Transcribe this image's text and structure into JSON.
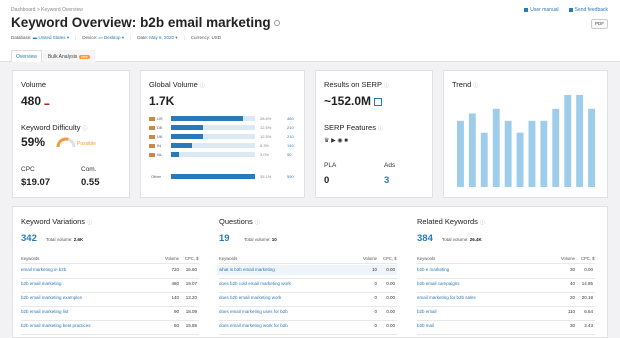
{
  "breadcrumb": [
    "Dashboard",
    "Keyword Overview"
  ],
  "top_links": {
    "manual": "User manual",
    "feedback": "Send feedback"
  },
  "title_prefix": "Keyword Overview:",
  "query": "b2b email marketing",
  "pdf_label": "PDF",
  "meta": {
    "db_label": "Database:",
    "db_value": "United States",
    "device_label": "Device:",
    "device_value": "Desktop",
    "date_label": "Date:",
    "date_value": "May 6, 2020",
    "currency_label": "Currency:",
    "currency_value": "USD"
  },
  "tabs": [
    {
      "label": "Overview"
    },
    {
      "label": "Bulk Analysis",
      "badge": "new"
    }
  ],
  "volume": {
    "title": "Volume",
    "value": "480",
    "flag": "US"
  },
  "kd": {
    "title": "Keyword Difficulty",
    "value": "59%",
    "label": "Possible",
    "fraction": 0.59
  },
  "cpc": {
    "title": "CPC",
    "value": "$19.07"
  },
  "com": {
    "title": "Com.",
    "value": "0.55"
  },
  "global": {
    "title": "Global Volume",
    "value": "1.7K",
    "rows": [
      {
        "code": "US",
        "pct": "28.6%",
        "num": "480",
        "fill": 0.286
      },
      {
        "code": "DE",
        "pct": "12.5%",
        "num": "210",
        "fill": 0.125
      },
      {
        "code": "UK",
        "pct": "12.5%",
        "num": "210",
        "fill": 0.125
      },
      {
        "code": "IN",
        "pct": "8.3%",
        "num": "140",
        "fill": 0.083
      },
      {
        "code": "NL",
        "pct": "3.0%",
        "num": "50",
        "fill": 0.03
      }
    ],
    "other": {
      "code": "Other",
      "pct": "35.1%",
      "num": "590",
      "fill": 0.351
    }
  },
  "serp": {
    "title": "Results on SERP",
    "value": "~152.0M",
    "features_title": "SERP Features",
    "pla_title": "PLA",
    "pla_value": "0",
    "ads_title": "Ads",
    "ads_value": "3"
  },
  "trend": {
    "title": "Trend",
    "values": [
      0.72,
      0.8,
      0.59,
      0.85,
      0.72,
      0.59,
      0.72,
      0.72,
      0.85,
      1.0,
      1.0,
      0.85
    ]
  },
  "variations": {
    "title": "Keyword Variations",
    "count": "342",
    "total_label": "Total volume:",
    "total": "2.6K",
    "headers": [
      "Keywords",
      "Volume",
      "CPC, $"
    ],
    "rows": [
      [
        "email marketing in b2b",
        "720",
        "16.60"
      ],
      [
        "b2b email marketing",
        "480",
        "19.07"
      ],
      [
        "b2b email marketing examples",
        "140",
        "13.20"
      ],
      [
        "b2b email marketing list",
        "90",
        "18.09"
      ],
      [
        "b2b email marketing best practices",
        "50",
        "15.85"
      ]
    ]
  },
  "questions": {
    "title": "Questions",
    "count": "19",
    "total_label": "Total volume:",
    "total": "10",
    "headers": [
      "Keywords",
      "Volume",
      "CPC, $"
    ],
    "rows": [
      [
        "what is b2b email marketing",
        "10",
        "0.00"
      ],
      [
        "does b2b cold email marketing work",
        "0",
        "0.00"
      ],
      [
        "does b2b email marketing work",
        "0",
        "0.00"
      ],
      [
        "does email marketing uses for b2b",
        "0",
        "0.00"
      ],
      [
        "does email marketing work for b2b",
        "0",
        "0.00"
      ]
    ]
  },
  "related": {
    "title": "Related Keywords",
    "count": "384",
    "total_label": "Total volume:",
    "total": "26.4K",
    "headers": [
      "Keywords",
      "Volume",
      "CPC, $"
    ],
    "rows": [
      [
        "b2b e marketing",
        "30",
        "0.00"
      ],
      [
        "b2b email campaigns",
        "40",
        "14.85"
      ],
      [
        "email marketing for b2b sales",
        "20",
        "20.18"
      ],
      [
        "b2b email",
        "110",
        "6.64"
      ],
      [
        "b2b mail",
        "30",
        "3.43"
      ]
    ]
  },
  "colors": {
    "accent": "#2a7ab8",
    "bar": "#9ecdeb",
    "orange": "#f39a3c"
  }
}
